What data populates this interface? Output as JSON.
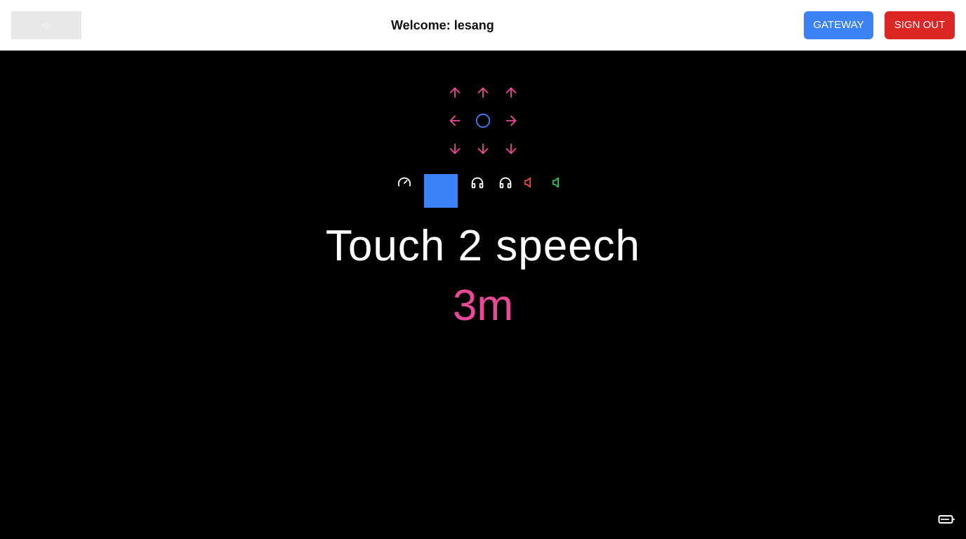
{
  "header": {
    "welcome_text": "Welcome: lesang",
    "gateway_label": "GATEWAY",
    "signout_label": "SIGN OUT"
  },
  "main": {
    "title": "Touch 2 speech",
    "distance": "3m"
  },
  "colors": {
    "arrow": "#ec4899",
    "center_circle": "#3b82f6",
    "gateway_button": "#3b82f6",
    "signout_button": "#dc2626",
    "square_button": "#3b82f6",
    "distance_text": "#ec4899",
    "icon_white": "#ffffff",
    "speaker_red": "#ef4444",
    "speaker_green": "#22c55e"
  },
  "icons": {
    "direction_pad": [
      "arrow-up-left",
      "arrow-up",
      "arrow-up-right",
      "arrow-left",
      "center-circle",
      "arrow-right",
      "arrow-down-left",
      "arrow-down",
      "arrow-down-right"
    ],
    "toolbar": [
      "speedometer-icon",
      "stop-square",
      "headphones-icon",
      "headphones-icon",
      "speaker-icon",
      "speaker-icon"
    ],
    "corner": "keyboard-icon"
  }
}
